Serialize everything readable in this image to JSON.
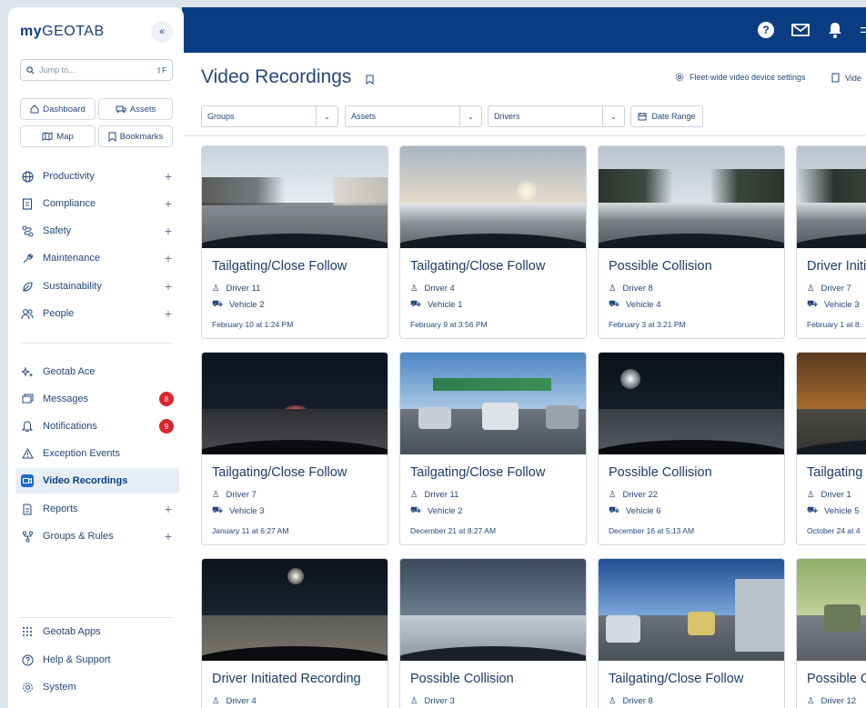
{
  "brand": {
    "prefix": "my",
    "name": "GEOTAB"
  },
  "collapse_label": "«",
  "search": {
    "placeholder": "Jump to...",
    "shortcut": "⇧F"
  },
  "quick_links": [
    {
      "label": "Dashboard",
      "icon": "home-icon"
    },
    {
      "label": "Assets",
      "icon": "truck-icon"
    },
    {
      "label": "Map",
      "icon": "map-icon"
    },
    {
      "label": "Bookmarks",
      "icon": "bookmark-icon"
    }
  ],
  "nav": {
    "productivity": "Productivity",
    "compliance": "Compliance",
    "safety": "Safety",
    "maintenance": "Maintenance",
    "sustainability": "Sustainability",
    "people": "People",
    "geotab_ace": "Geotab Ace",
    "messages": "Messages",
    "messages_badge": "8",
    "notifications": "Notifications",
    "notifications_badge": "9",
    "exception_events": "Exception Events",
    "video_recordings": "Video Recordings",
    "reports": "Reports",
    "groups_rules": "Groups & Rules",
    "geotab_apps": "Geotab Apps",
    "help_support": "Help & Support",
    "system": "System"
  },
  "header": {
    "title": "Video Recordings",
    "fleet_settings": "Fleet-wide video device settings",
    "video_link": "Vide"
  },
  "filters": {
    "groups": "Groups",
    "assets": "Assets",
    "drivers": "Drivers",
    "date_range": "Date Range"
  },
  "colors": {
    "brand_blue": "#0b3d84",
    "accent_blue": "#1b6ad0",
    "badge_red": "#d8282f"
  },
  "cards": [
    {
      "title": "Tailgating/Close Follow",
      "driver": "Driver 11",
      "vehicle": "Vehicle 2",
      "date": "February 10 at 1:24 PM"
    },
    {
      "title": "Tailgating/Close Follow",
      "driver": "Driver 4",
      "vehicle": "Vehicle 1",
      "date": "February 9 at 3:56 PM"
    },
    {
      "title": "Possible Collision",
      "driver": "Driver 8",
      "vehicle": "Vehicle 4",
      "date": "February 3 at 3:21 PM"
    },
    {
      "title": "Driver Initi",
      "driver": "Driver 7",
      "vehicle": "Vehicle 3",
      "date": "February 1 at 8:"
    },
    {
      "title": "Tailgating/Close Follow",
      "driver": "Driver 7",
      "vehicle": "Vehicle 3",
      "date": "January 11 at 6:27 AM"
    },
    {
      "title": "Tailgating/Close Follow",
      "driver": "Driver 11",
      "vehicle": "Vehicle 2",
      "date": "December 21 at 8:27 AM"
    },
    {
      "title": "Possible Collision",
      "driver": "Driver 22",
      "vehicle": "Vehicle 6",
      "date": "December 16 at 5:13 AM"
    },
    {
      "title": "Tailgating",
      "driver": "Driver 1",
      "vehicle": "Vehicle 5",
      "date": "October 24 at 4"
    },
    {
      "title": "Driver Initiated Recording",
      "driver": "Driver 4"
    },
    {
      "title": "Possible Collision",
      "driver": "Driver 3"
    },
    {
      "title": "Tailgating/Close Follow",
      "driver": "Driver 8"
    },
    {
      "title": "Possible C",
      "driver": "Driver 12"
    }
  ]
}
